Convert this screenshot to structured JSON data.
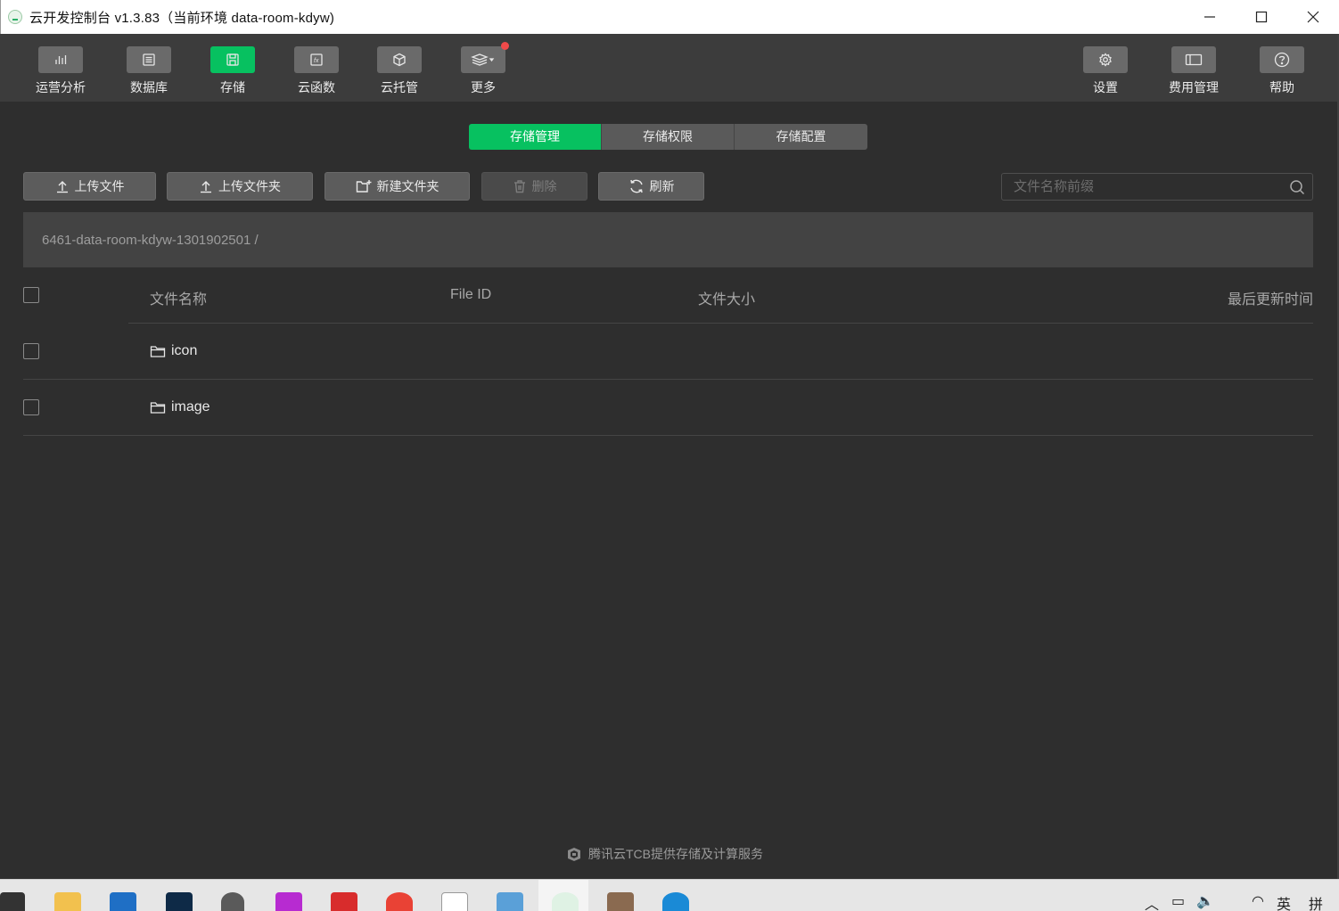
{
  "window": {
    "title": "云开发控制台 v1.3.83（当前环境 data-room-kdyw)",
    "minimize_label": "minimize",
    "maximize_label": "maximize",
    "close_label": "close"
  },
  "toolbar": {
    "left": [
      {
        "label": "运营分析",
        "icon": "bar-chart-icon"
      },
      {
        "label": "数据库",
        "icon": "database-icon"
      },
      {
        "label": "存储",
        "icon": "storage-icon",
        "active": true
      },
      {
        "label": "云函数",
        "icon": "function-icon"
      },
      {
        "label": "云托管",
        "icon": "cube-icon"
      },
      {
        "label": "更多",
        "icon": "layers-icon",
        "badge": "red-dot"
      }
    ],
    "right": [
      {
        "label": "设置",
        "icon": "gear-icon"
      },
      {
        "label": "费用管理",
        "icon": "billing-icon"
      },
      {
        "label": "帮助",
        "icon": "help-icon"
      }
    ]
  },
  "tabs": [
    {
      "label": "存储管理",
      "active": true
    },
    {
      "label": "存储权限",
      "active": false
    },
    {
      "label": "存储配置",
      "active": false
    }
  ],
  "actions": {
    "upload_file": "上传文件",
    "upload_folder": "上传文件夹",
    "new_folder": "新建文件夹",
    "delete": "删除",
    "refresh": "刷新"
  },
  "search": {
    "placeholder": "文件名称前缀",
    "value": ""
  },
  "path": "6461-data-room-kdyw-1301902501 /",
  "table": {
    "columns": [
      "文件名称",
      "File ID",
      "文件大小",
      "最后更新时间"
    ],
    "rows": [
      {
        "name": "icon",
        "type": "folder",
        "file_id": "",
        "size": "",
        "updated": ""
      },
      {
        "name": "image",
        "type": "folder",
        "file_id": "",
        "size": "",
        "updated": ""
      }
    ]
  },
  "footer": {
    "text": "腾讯云TCB提供存储及计算服务"
  },
  "colors": {
    "accent": "#07c160",
    "background": "#2e2e2e",
    "toolbar": "#3c3c3c",
    "badge": "#f04a4a"
  },
  "taskbar": {
    "tray_lang": "英",
    "tray_ime": "拼"
  }
}
